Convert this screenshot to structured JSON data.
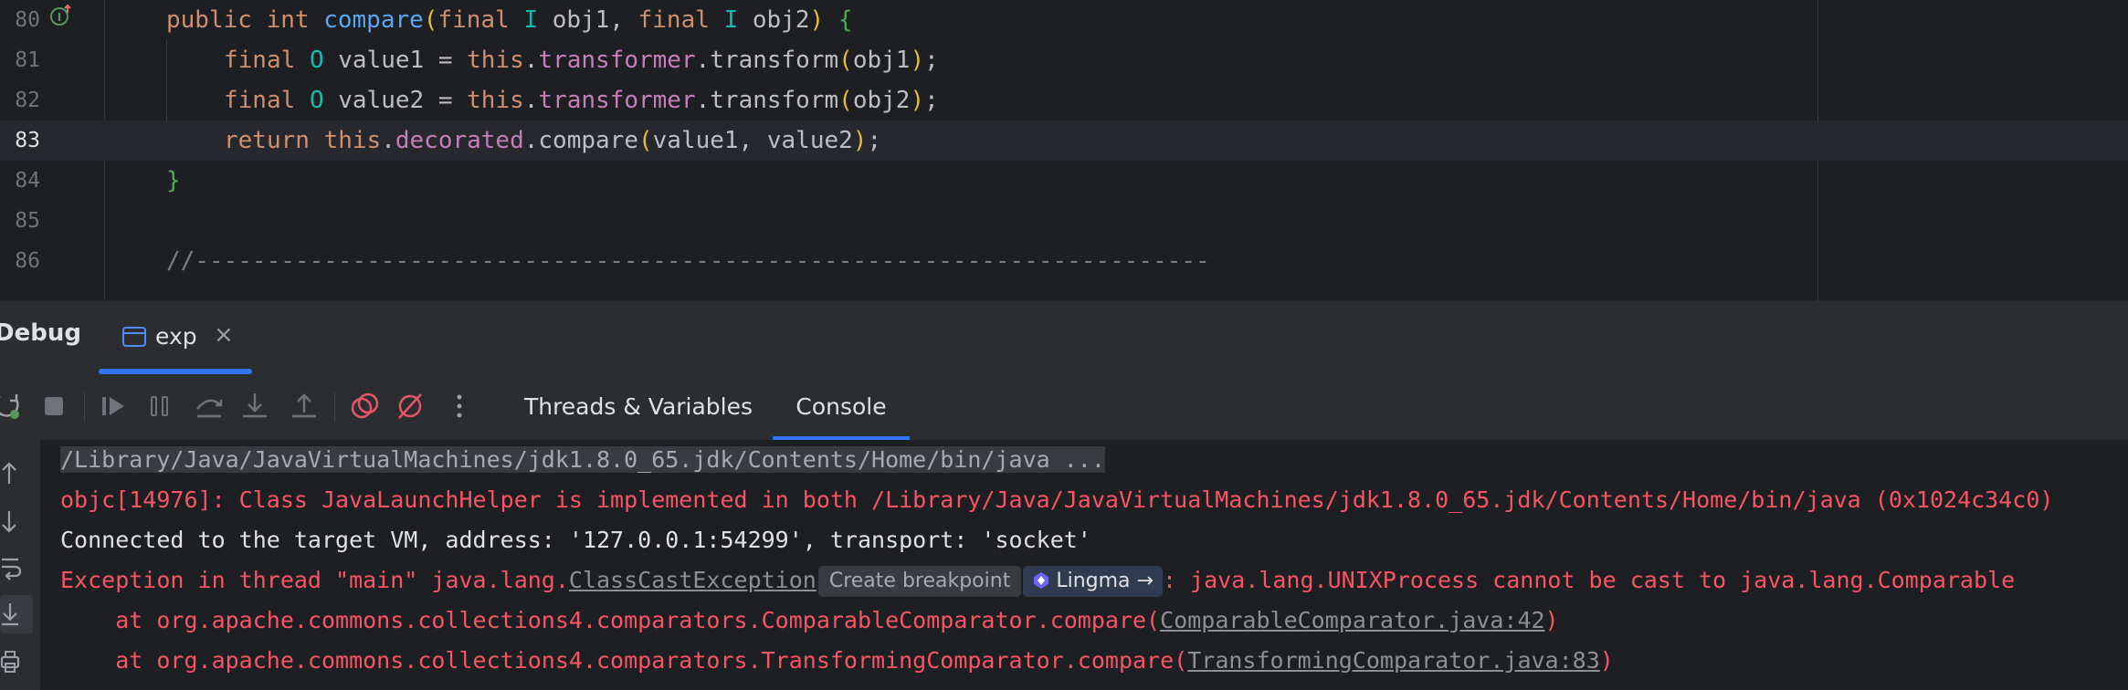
{
  "editor": {
    "lines": [
      {
        "num": "80"
      },
      {
        "num": "81"
      },
      {
        "num": "82"
      },
      {
        "num": "83"
      },
      {
        "num": "84"
      },
      {
        "num": "85"
      },
      {
        "num": "86"
      }
    ],
    "tokens": {
      "l80_public": "public",
      "l80_int": "int",
      "l80_compare": "compare",
      "l80_open": "(",
      "l80_final1": "final",
      "l80_I1": "I",
      "l80_obj1": "obj1,",
      "l80_final2": "final",
      "l80_I2": "I",
      "l80_obj2": "obj2",
      "l80_close": ")",
      "l80_brace": "{",
      "l81_final": "final",
      "l81_O": "O",
      "l81_decl": "value1 =",
      "l81_this": "this",
      "l81_dot1": ".",
      "l81_field": "transformer",
      "l81_call": ".transform",
      "l81_open": "(",
      "l81_arg": "obj1",
      "l81_close": ")",
      "l81_end": ";",
      "l82_final": "final",
      "l82_O": "O",
      "l82_decl": "value2 =",
      "l82_this": "this",
      "l82_dot1": ".",
      "l82_field": "transformer",
      "l82_call": ".transform",
      "l82_open": "(",
      "l82_arg": "obj2",
      "l82_close": ")",
      "l82_end": ";",
      "l83_return": "return",
      "l83_this": "this",
      "l83_dot1": ".",
      "l83_field": "decorated",
      "l83_call": ".compare",
      "l83_open": "(",
      "l83_args": "value1, value2",
      "l83_close": ")",
      "l83_end": ";",
      "l84_brace": "}",
      "l86_comment": "//-----------------------------------------------------------------------"
    }
  },
  "debug": {
    "title": "Debug",
    "session_tab": "exp",
    "close_glyph": "×",
    "view_tabs": {
      "threads": "Threads & Variables",
      "console": "Console"
    }
  },
  "toolbar_icons": [
    "rerun-icon",
    "stop-icon",
    "resume-icon",
    "pause-icon",
    "step-over-icon",
    "step-into-icon",
    "step-out-icon",
    "view-breakpoints-icon",
    "mute-breakpoints-icon",
    "more-icon"
  ],
  "console": {
    "cmd": "/Library/Java/JavaVirtualMachines/jdk1.8.0_65.jdk/Contents/Home/bin/java ...",
    "objc": "objc[14976]: Class JavaLaunchHelper is implemented in both /Library/Java/JavaVirtualMachines/jdk1.8.0_65.jdk/Contents/Home/bin/java (0x1024c34c0)",
    "connected": "Connected to the target VM, address: '127.0.0.1:54299', transport: 'socket'",
    "exc_prefix": "Exception in thread \"main\" java.lang.",
    "exc_class": "ClassCastException",
    "hint_breakpoint": "Create breakpoint",
    "hint_lingma": "Lingma →",
    "exc_suffix": ": java.lang.UNIXProcess cannot be cast to java.lang.Comparable",
    "at1_prefix": "    at org.apache.commons.collections4.comparators.ComparableComparator.compare(",
    "at1_link": "ComparableComparator.java:42",
    "at1_suffix": ")",
    "at2_prefix": "    at org.apache.commons.collections4.comparators.TransformingComparator.compare(",
    "at2_link": "TransformingComparator.java:83",
    "at2_suffix": ")"
  },
  "colors": {
    "accent": "#3574f0",
    "error": "#f75464",
    "keyword": "#cf8e6d",
    "function": "#56a8f5",
    "field": "#c77dbb"
  }
}
